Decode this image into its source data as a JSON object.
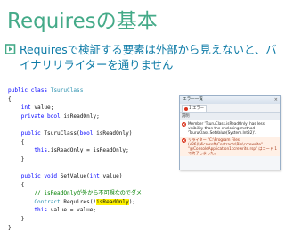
{
  "slide": {
    "title": "Requiresの基本",
    "bullet": "Requiresで検証する要素は外部から見えないと、バイナリリライターを通りません"
  },
  "code_lines": [
    [
      {
        "t": "public ",
        "c": "kw"
      },
      {
        "t": "class ",
        "c": "kw"
      },
      {
        "t": "TsuruClass",
        "c": "ty"
      }
    ],
    [
      {
        "t": "{",
        "c": ""
      }
    ],
    [
      {
        "t": "    ",
        "c": ""
      },
      {
        "t": "int ",
        "c": "kw"
      },
      {
        "t": "value;",
        "c": ""
      }
    ],
    [
      {
        "t": "    ",
        "c": ""
      },
      {
        "t": "private ",
        "c": "kw"
      },
      {
        "t": "bool ",
        "c": "kw"
      },
      {
        "t": "isReadOnly;",
        "c": ""
      }
    ],
    [
      {
        "t": "",
        "c": ""
      }
    ],
    [
      {
        "t": "    ",
        "c": ""
      },
      {
        "t": "public ",
        "c": "kw"
      },
      {
        "t": "TsuruClass(",
        "c": ""
      },
      {
        "t": "bool ",
        "c": "kw"
      },
      {
        "t": "isReadOnly)",
        "c": ""
      }
    ],
    [
      {
        "t": "    {",
        "c": ""
      }
    ],
    [
      {
        "t": "        ",
        "c": ""
      },
      {
        "t": "this",
        "c": "kw"
      },
      {
        "t": ".isReadOnly = isReadOnly;",
        "c": ""
      }
    ],
    [
      {
        "t": "    }",
        "c": ""
      }
    ],
    [
      {
        "t": "",
        "c": ""
      }
    ],
    [
      {
        "t": "    ",
        "c": ""
      },
      {
        "t": "public ",
        "c": "kw"
      },
      {
        "t": "void ",
        "c": "kw"
      },
      {
        "t": "SetValue(",
        "c": ""
      },
      {
        "t": "int ",
        "c": "kw"
      },
      {
        "t": "value)",
        "c": ""
      }
    ],
    [
      {
        "t": "    {",
        "c": ""
      }
    ],
    [
      {
        "t": "        ",
        "c": ""
      },
      {
        "t": "// isReadOnlyが外から不可視なのでダメ",
        "c": "cm"
      }
    ],
    [
      {
        "t": "        ",
        "c": ""
      },
      {
        "t": "Contract",
        "c": "ty"
      },
      {
        "t": ".Requires(!",
        "c": ""
      },
      {
        "t": "isReadOnly",
        "c": "hl"
      },
      {
        "t": ");",
        "c": ""
      }
    ],
    [
      {
        "t": "        ",
        "c": ""
      },
      {
        "t": "this",
        "c": "kw"
      },
      {
        "t": ".value = value;",
        "c": ""
      }
    ],
    [
      {
        "t": "    }",
        "c": ""
      }
    ],
    [
      {
        "t": "}",
        "c": ""
      }
    ]
  ],
  "error_list": {
    "title": "エラー一覧",
    "close": "×",
    "tab_label": "1 エラー",
    "column_header": "説明",
    "rows": [
      {
        "text": "Member 'TsuruClass.isReadOnly' has less visibility than the enclosing method 'TsuruClass.SetValue(System.Int32)'.",
        "kind": "error"
      },
      {
        "text": "リライター \"C:\\Program Files (x86)\\Microsoft\\Contracts\\Bin\\ccrewrite\" \"@ConsoleApplication1ccrewrite.rsp\" はコード 1 で終了しました。",
        "kind": "error"
      }
    ]
  },
  "colors": {
    "title": "#44aa88",
    "bullet": "#0d7ba7",
    "bullet_mark": "#44aa88",
    "keyword": "#0000ff",
    "type": "#2b91af",
    "comment": "#008000",
    "highlight": "#fff200",
    "error_icon": "#d9331c"
  }
}
